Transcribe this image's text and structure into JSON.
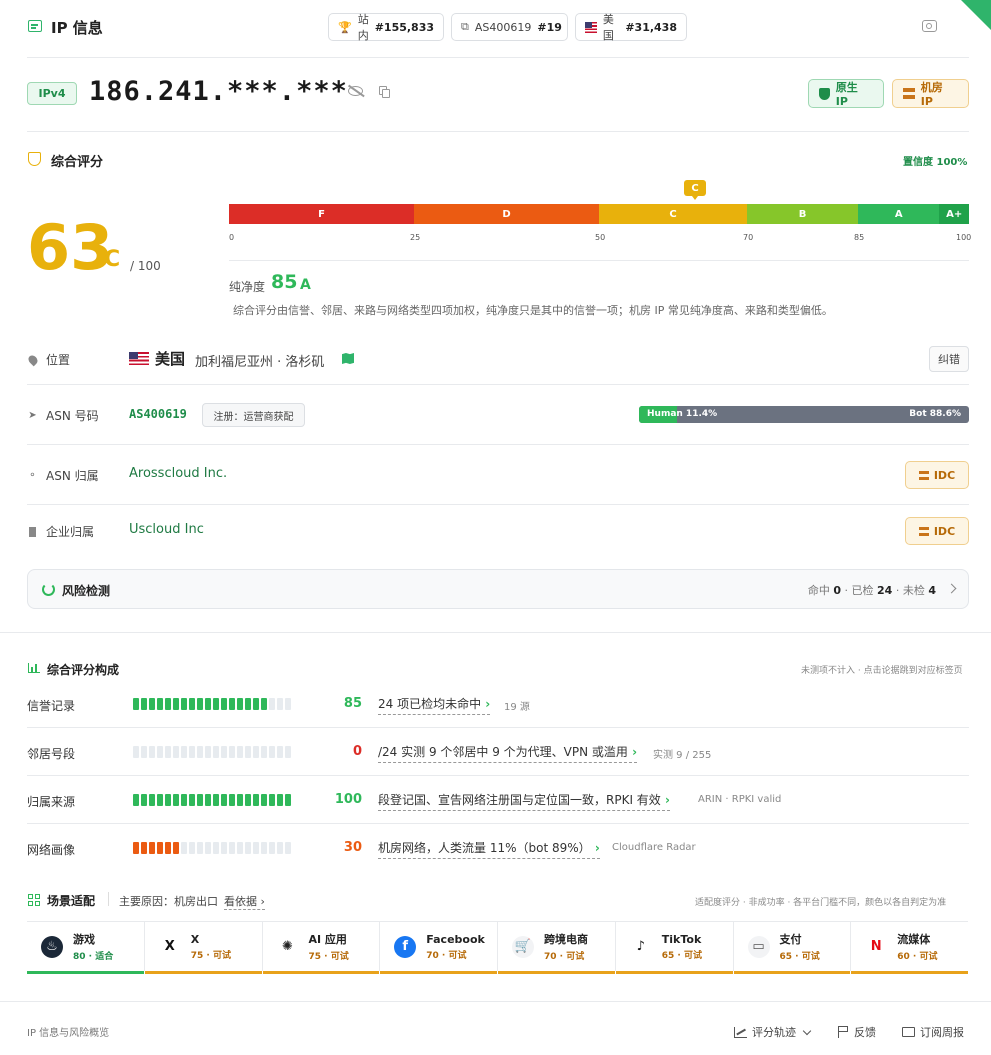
{
  "header": {
    "title": "IP 信息",
    "pills": [
      {
        "label": "站内",
        "value": "#155,833"
      },
      {
        "label": "AS400619",
        "value": "#19"
      },
      {
        "label": "美国",
        "value": "#31,438"
      }
    ]
  },
  "ip": {
    "version": "IPv4",
    "address": "186.241.***.***",
    "tags": {
      "native": "原生 IP",
      "datacenter": "机房 IP"
    }
  },
  "score": {
    "section_title": "综合评分",
    "confidence": "置信度 100%",
    "value": "63",
    "grade": "C",
    "max": "/ 100",
    "marker": "C",
    "segments": [
      {
        "label": "F",
        "from": 0,
        "to": 25,
        "color": "#dc2d27"
      },
      {
        "label": "D",
        "from": 25,
        "to": 50,
        "color": "#eb5b12"
      },
      {
        "label": "C",
        "from": 50,
        "to": 70,
        "color": "#e8b10c"
      },
      {
        "label": "B",
        "from": 70,
        "to": 85,
        "color": "#86c62a"
      },
      {
        "label": "A",
        "from": 85,
        "to": 96,
        "color": "#2fb85a"
      },
      {
        "label": "A+",
        "from": 96,
        "to": 100,
        "color": "#20a24a"
      }
    ],
    "ticks": [
      "0",
      "25",
      "50",
      "70",
      "85",
      "100"
    ],
    "purity_label": "纯净度",
    "purity_value": "85",
    "purity_grade": "A",
    "note": "综合评分由信誉、邻居、来路与网络类型四项加权，纯净度只是其中的信誉一项；机房 IP 常见纯净度高、来路和类型偏低。"
  },
  "info": {
    "location_label": "位置",
    "country": "美国",
    "region": "加利福尼亚州 · 洛杉矶",
    "correct_button": "纠错",
    "asn_label": "ASN 号码",
    "asn": "AS400619",
    "asn_reg": "注册：运营商获配",
    "human_label": "Human 11.4%",
    "bot_label": "Bot 88.6%",
    "human_pct": 11.4,
    "asn_owner_label": "ASN 归属",
    "asn_owner": "Arosscloud Inc.",
    "org_label": "企业归属",
    "org": "Uscloud Inc",
    "idc": "IDC"
  },
  "risk": {
    "title": "风险检测",
    "hit_label": "命中",
    "hit": "0",
    "checked_label": "已检",
    "checked": "24",
    "unchecked_label": "未检",
    "unchecked": "4"
  },
  "breakdown": {
    "title": "综合评分构成",
    "hint": "未测项不计入 · 点击论据跳到对应标签页",
    "rows": [
      {
        "label": "信誉记录",
        "score": "85",
        "filled": 17,
        "color": "#2fb85a",
        "desc": "24 项已检均未命中",
        "note": "19 源"
      },
      {
        "label": "邻居号段",
        "score": "0",
        "filled": 0,
        "color": "#dc2d27",
        "desc": "/24 实测 9 个邻居中 9 个为代理、VPN 或滥用",
        "note": "实测 9 / 255"
      },
      {
        "label": "归属来源",
        "score": "100",
        "filled": 20,
        "color": "#2fb85a",
        "desc": "段登记国、宣告网络注册国与定位国一致，RPKI 有效",
        "note": "ARIN · RPKI valid"
      },
      {
        "label": "网络画像",
        "score": "30",
        "filled": 6,
        "color": "#eb5b12",
        "desc": "机房网络，人类流量 11%（bot 89%）",
        "note": "Cloudflare Radar"
      }
    ]
  },
  "scenes": {
    "title": "场景适配",
    "reason_label": "主要原因：机房出口",
    "evidence_link": "看依据",
    "hint": "适配度评分 · 非成功率 · 各平台门槛不同，颜色以各自判定为准",
    "items": [
      {
        "name": "游戏",
        "sub": "80 · 适合",
        "icon": "steam-icon"
      },
      {
        "name": "X",
        "sub": "75 · 可试",
        "icon": "x-icon"
      },
      {
        "name": "AI 应用",
        "sub": "75 · 可试",
        "icon": "openai-icon"
      },
      {
        "name": "Facebook",
        "sub": "70 · 可试",
        "icon": "facebook-icon"
      },
      {
        "name": "跨境电商",
        "sub": "70 · 可试",
        "icon": "cart-icon"
      },
      {
        "name": "TikTok",
        "sub": "65 · 可试",
        "icon": "tiktok-icon"
      },
      {
        "name": "支付",
        "sub": "65 · 可试",
        "icon": "card-icon"
      },
      {
        "name": "流媒体",
        "sub": "60 · 可试",
        "icon": "netflix-icon"
      }
    ]
  },
  "footer": {
    "caption": "IP 信息与风险概览",
    "trend": "评分轨迹",
    "feedback": "反馈",
    "subscribe": "订阅周报"
  }
}
